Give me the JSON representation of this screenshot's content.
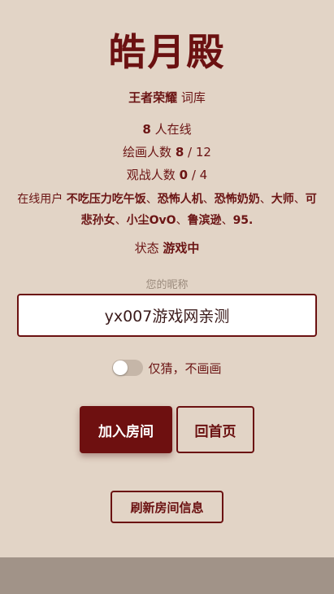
{
  "room": {
    "title": "皓月殿"
  },
  "lexicon": {
    "name": "王者荣耀",
    "suffix": "词库"
  },
  "stats": {
    "online_count": "8",
    "online_label": "人在线",
    "painter_label": "绘画人数",
    "painter_current": "8",
    "painter_max": "12",
    "spectator_label": "观战人数",
    "spectator_current": "0",
    "spectator_max": "4",
    "separator": "/"
  },
  "online_users": {
    "label": "在线用户",
    "users": [
      "不吃压力吃午饭",
      "恐怖人机",
      "恐怖奶奶",
      "大师",
      "可悲孙女",
      "小尘OvO",
      "鲁滨逊",
      "95."
    ],
    "separator": "、"
  },
  "status": {
    "label": "状态",
    "value": "游戏中"
  },
  "nickname": {
    "label": "您的昵称",
    "value": "yx007游戏网亲测"
  },
  "toggle": {
    "label": "仅猜，不画画",
    "checked": false
  },
  "buttons": {
    "join": "加入房间",
    "home": "回首页",
    "refresh": "刷新房间信息"
  }
}
